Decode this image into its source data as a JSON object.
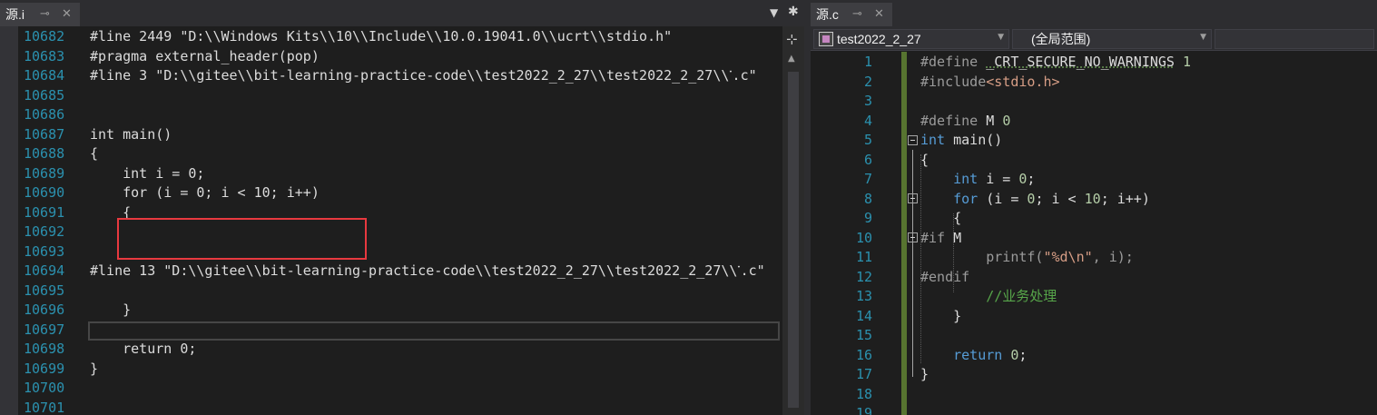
{
  "left_tab": {
    "label": "源.i",
    "pin_icon": "pin-icon",
    "close_icon": "close-icon"
  },
  "left_tools": {
    "dropdown_icon": "dropdown-arrow-icon",
    "settings_icon": "gear-icon"
  },
  "left_lines": [
    {
      "num": "10682",
      "text": "#line 2449 \"D:\\\\Windows Kits\\\\10\\\\Include\\\\10.0.19041.0\\\\ucrt\\\\stdio.h\""
    },
    {
      "num": "10683",
      "text": "#pragma external_header(pop)"
    },
    {
      "num": "10684",
      "text": "#line 3 \"D:\\\\gitee\\\\bit-learning-practice-code\\\\test2022_2_27\\\\test2022_2_27\\\\་.c\""
    },
    {
      "num": "10685",
      "text": ""
    },
    {
      "num": "10686",
      "text": ""
    },
    {
      "num": "10687",
      "text": "int main()"
    },
    {
      "num": "10688",
      "text": "{"
    },
    {
      "num": "10689",
      "text": "    int i = 0;"
    },
    {
      "num": "10690",
      "text": "    for (i = 0; i < 10; i++)"
    },
    {
      "num": "10691",
      "text": "    {"
    },
    {
      "num": "10692",
      "text": ""
    },
    {
      "num": "10693",
      "text": ""
    },
    {
      "num": "10694",
      "text": "#line 13 \"D:\\\\gitee\\\\bit-learning-practice-code\\\\test2022_2_27\\\\test2022_2_27\\\\་.c\""
    },
    {
      "num": "10695",
      "text": ""
    },
    {
      "num": "10696",
      "text": "    }"
    },
    {
      "num": "10697",
      "text": ""
    },
    {
      "num": "10698",
      "text": "    return 0;"
    },
    {
      "num": "10699",
      "text": "}"
    },
    {
      "num": "10700",
      "text": ""
    },
    {
      "num": "10701",
      "text": ""
    }
  ],
  "right_tab": {
    "label": "源.c",
    "pin_icon": "pin-icon",
    "close_icon": "close-icon"
  },
  "navbar": {
    "project": "test2022_2_27",
    "scope": "(全局范围)"
  },
  "right_lines": [
    {
      "num": "1",
      "parts": [
        [
          "pp",
          "#define "
        ],
        [
          "txt squiggle",
          "_CRT_SECURE_NO_WARNINGS"
        ],
        [
          "txt",
          " "
        ],
        [
          "num",
          "1"
        ]
      ]
    },
    {
      "num": "2",
      "parts": [
        [
          "pp",
          "#include"
        ],
        [
          "str",
          "<stdio.h>"
        ]
      ]
    },
    {
      "num": "3",
      "parts": []
    },
    {
      "num": "4",
      "parts": [
        [
          "pp",
          "#define "
        ],
        [
          "txt",
          "M "
        ],
        [
          "num",
          "0"
        ]
      ]
    },
    {
      "num": "5",
      "parts": [
        [
          "kw",
          "int"
        ],
        [
          "txt",
          " main()"
        ]
      ]
    },
    {
      "num": "6",
      "parts": [
        [
          "txt",
          "{"
        ]
      ]
    },
    {
      "num": "7",
      "parts": [
        [
          "txt",
          "    "
        ],
        [
          "kw",
          "int"
        ],
        [
          "txt",
          " i = "
        ],
        [
          "num",
          "0"
        ],
        [
          "txt",
          ";"
        ]
      ]
    },
    {
      "num": "8",
      "parts": [
        [
          "txt",
          "    "
        ],
        [
          "kw",
          "for"
        ],
        [
          "txt",
          " (i = "
        ],
        [
          "num",
          "0"
        ],
        [
          "txt",
          "; i < "
        ],
        [
          "num",
          "10"
        ],
        [
          "txt",
          "; i++)"
        ]
      ]
    },
    {
      "num": "9",
      "parts": [
        [
          "txt",
          "    {"
        ]
      ]
    },
    {
      "num": "10",
      "parts": [
        [
          "pp",
          "#if "
        ],
        [
          "txt",
          "M"
        ]
      ]
    },
    {
      "num": "11",
      "parts": [
        [
          "pp",
          "        printf("
        ],
        [
          "fmt",
          "\"%d\\n\""
        ],
        [
          "pp",
          ", i);"
        ]
      ]
    },
    {
      "num": "12",
      "parts": [
        [
          "pp",
          "#endif"
        ]
      ]
    },
    {
      "num": "13",
      "parts": [
        [
          "txt",
          "        "
        ],
        [
          "cmt",
          "//业务处理"
        ]
      ]
    },
    {
      "num": "14",
      "parts": [
        [
          "txt",
          "    }"
        ]
      ]
    },
    {
      "num": "15",
      "parts": []
    },
    {
      "num": "16",
      "parts": [
        [
          "txt",
          "    "
        ],
        [
          "kw",
          "return"
        ],
        [
          "txt",
          " "
        ],
        [
          "num",
          "0"
        ],
        [
          "txt",
          ";"
        ]
      ]
    },
    {
      "num": "17",
      "parts": [
        [
          "txt",
          "}"
        ]
      ]
    },
    {
      "num": "18",
      "parts": []
    },
    {
      "num": "19",
      "parts": []
    }
  ],
  "colors": {
    "keyword": "#569cd6",
    "preprocessor": "#9b9b9b",
    "string": "#d69d85",
    "comment": "#57a64a",
    "number": "#b5cea8",
    "line_number": "#2b91af",
    "highlight_box": "#e8393f"
  }
}
